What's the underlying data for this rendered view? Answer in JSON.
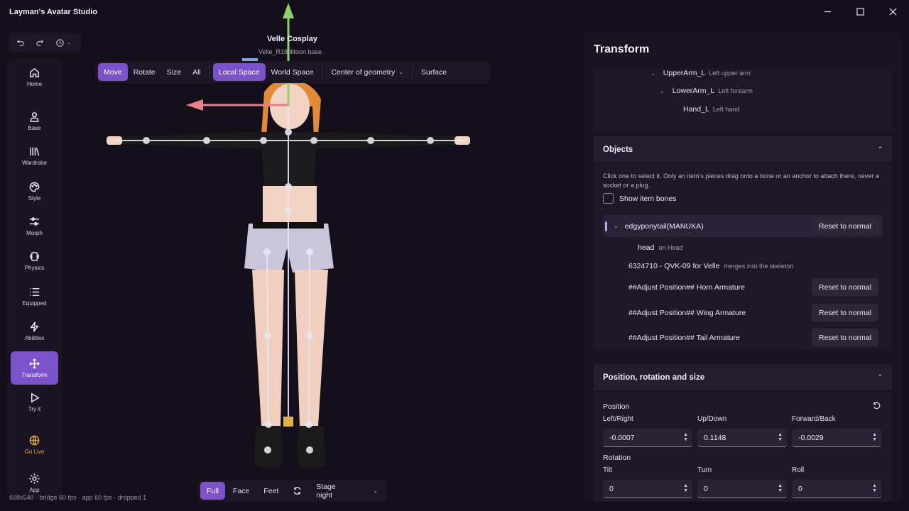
{
  "app": {
    "title": "Layman's Avatar Studio"
  },
  "history": {
    "undo": "undo-icon",
    "redo": "redo-icon",
    "history": "history-icon"
  },
  "nav": {
    "items": [
      {
        "label": "Home",
        "icon": "home-icon"
      },
      {
        "label": "Base",
        "icon": "person-icon"
      },
      {
        "label": "Wardrobe",
        "icon": "wardrobe-icon"
      },
      {
        "label": "Style",
        "icon": "palette-icon"
      },
      {
        "label": "Morph",
        "icon": "sliders-icon"
      },
      {
        "label": "Physics",
        "icon": "physics-icon"
      },
      {
        "label": "Equipped",
        "icon": "list-icon"
      },
      {
        "label": "Abilities",
        "icon": "bolt-icon"
      },
      {
        "label": "Transform",
        "icon": "move-icon"
      },
      {
        "label": "Try it",
        "icon": "play-icon"
      },
      {
        "label": "Go Live",
        "icon": "globe-icon"
      },
      {
        "label": "App",
        "icon": "gear-icon"
      }
    ],
    "active": "Transform"
  },
  "viewport": {
    "model_name": "Velle Cosplay",
    "model_sub": "Velle_R18 liltoon base",
    "toolbar": {
      "move": "Move",
      "rotate": "Rotate",
      "size": "Size",
      "all": "All",
      "local_space": "Local Space",
      "world_space": "World Space",
      "pivot": "Center of geometry",
      "surface": "Surface"
    },
    "status": "608x540 · bridge 60 fps · app 60 fps · dropped 1",
    "bottom": {
      "full": "Full",
      "face": "Face",
      "feet": "Feet",
      "stage": "Stage night"
    }
  },
  "panel": {
    "title": "Transform",
    "tree": [
      {
        "name": "UpperArm_L",
        "hint": "Left upper arm"
      },
      {
        "name": "LowerArm_L",
        "hint": "Left forearm"
      },
      {
        "name": "Hand_L",
        "hint": "Left hand"
      }
    ],
    "objects": {
      "title": "Objects",
      "description": "Click one to select it. Only an item's pieces drag onto a bone or an anchor to attach there, never a socket or a plug.",
      "show_bones": "Show item bones",
      "reset_label": "Reset to normal",
      "rows": [
        {
          "name": "edgyponytail(MANUKA)",
          "hint": ""
        },
        {
          "name": "head",
          "hint": "on Head"
        },
        {
          "name": "6324710 - QVK-09 for Velle",
          "hint": "merges into the skeleton"
        },
        {
          "name": "##Adjust Position## Horn Armature",
          "hint": ""
        },
        {
          "name": "##Adjust Position## Wing Armature",
          "hint": ""
        },
        {
          "name": "##Adjust Position## Tail Armature",
          "hint": ""
        }
      ]
    },
    "prs": {
      "title": "Position, rotation and size",
      "position_label": "Position",
      "rotation_label": "Rotation",
      "pos_fields": [
        {
          "label": "Left/Right",
          "value": "-0.0007"
        },
        {
          "label": "Up/Down",
          "value": "0.1148"
        },
        {
          "label": "Forward/Back",
          "value": "-0.0029"
        }
      ],
      "rot_fields": [
        {
          "label": "Tilt",
          "value": "0"
        },
        {
          "label": "Turn",
          "value": "0"
        },
        {
          "label": "Roll",
          "value": "0"
        }
      ]
    }
  },
  "colors": {
    "accent": "#7b52c9",
    "golive": "#d9a441",
    "gizmo_y": "#8fd16a",
    "gizmo_x": "#e8828a"
  }
}
